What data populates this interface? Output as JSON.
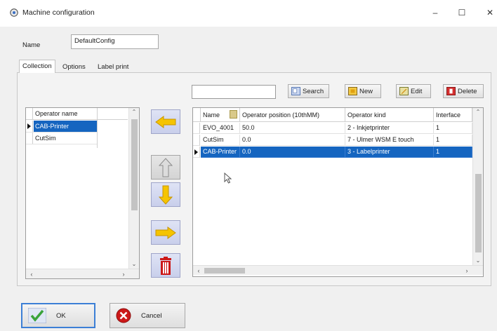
{
  "window": {
    "title": "Machine configuration",
    "controls": {
      "minimize": "–",
      "maximize": "☐",
      "close": "✕"
    }
  },
  "config_name": {
    "label": "Name",
    "value": "DefaultConfig"
  },
  "tabs": [
    {
      "label": "Collection",
      "active": true
    },
    {
      "label": "Options",
      "active": false
    },
    {
      "label": "Label print",
      "active": false
    }
  ],
  "search": {
    "value": "",
    "button": "Search"
  },
  "toolbar": {
    "new": "New",
    "edit": "Edit",
    "delete": "Delete"
  },
  "operator_list": {
    "header": "Operator name",
    "rows": [
      {
        "name": "CAB-Printer",
        "selected": true
      },
      {
        "name": "CutSim",
        "selected": false
      }
    ]
  },
  "grid": {
    "columns": [
      "Name",
      "Operator position (10thMM)",
      "Operator kind",
      "Interface"
    ],
    "rows": [
      {
        "name": "EVO_4001",
        "position": "50.0",
        "kind": "2 - Inkjetprinter",
        "interface": "1",
        "selected": false
      },
      {
        "name": "CutSim",
        "position": "0.0",
        "kind": "7 - Ulmer WSM E touch",
        "interface": "1",
        "selected": false
      },
      {
        "name": "CAB-Printer",
        "position": "0.0",
        "kind": "3 - Labelprinter",
        "interface": "1",
        "selected": true
      }
    ]
  },
  "footer": {
    "ok": "OK",
    "cancel": "Cancel"
  },
  "colors": {
    "selection": "#1565c0",
    "arrow_yellow": "#f5c400",
    "arrow_orange": "#e2a400",
    "delete_red": "#cc1818",
    "ok_green": "#3aa33a"
  }
}
